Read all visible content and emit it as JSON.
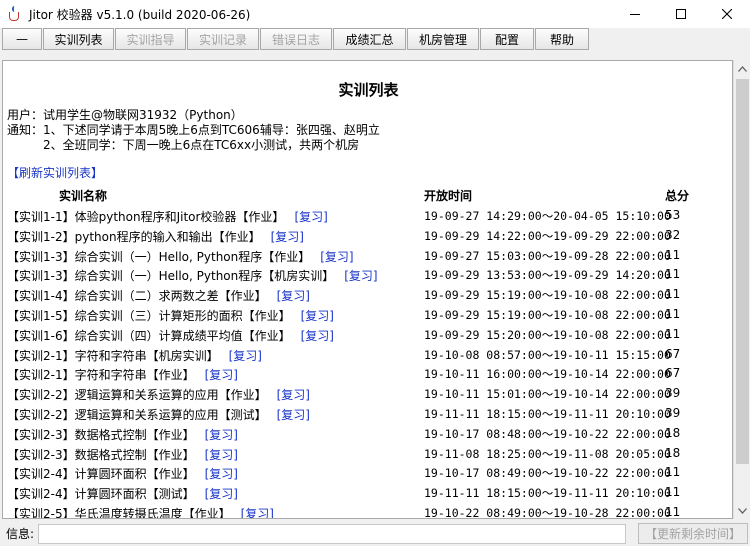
{
  "window": {
    "title": "Jitor 校验器 v5.1.0 (build 2020-06-26)"
  },
  "menu": [
    {
      "label": "—",
      "enabled": true
    },
    {
      "label": "实训列表",
      "enabled": true
    },
    {
      "label": "实训指导",
      "enabled": false
    },
    {
      "label": "实训记录",
      "enabled": false
    },
    {
      "label": "错误日志",
      "enabled": false
    },
    {
      "label": "成绩汇总",
      "enabled": true
    },
    {
      "label": "机房管理",
      "enabled": true
    },
    {
      "label": "配置",
      "enabled": true
    },
    {
      "label": "帮助",
      "enabled": true
    }
  ],
  "page": {
    "title": "实训列表",
    "user_line": "用户：试用学生@物联网31932（Python）",
    "notice_line1": "通知：1、下述同学请于本周5晚上6点到TC606辅导：张四强、赵明立",
    "notice_line2": "2、全班同学：下周一晚上6点在TC6xx小测试，共两个机房",
    "refresh_link": "【刷新实训列表】",
    "col_name": "实训名称",
    "col_time": "开放时间",
    "col_score": "总分",
    "review_label": "[复习]"
  },
  "rows": [
    {
      "name": "【实训1-1】体验python程序和Jitor校验器【作业】",
      "time": "19-09-27 14:29:00～20-04-05 15:10:00",
      "score": "53"
    },
    {
      "name": "【实训1-2】python程序的输入和输出【作业】",
      "time": "19-09-29 14:22:00～19-09-29 22:00:00",
      "score": "32"
    },
    {
      "name": "【实训1-3】综合实训（一）Hello, Python程序【作业】",
      "time": "19-09-27 15:03:00～19-09-28 22:00:00",
      "score": "11"
    },
    {
      "name": "【实训1-3】综合实训（一）Hello, Python程序【机房实训】",
      "time": "19-09-29 13:53:00～19-09-29 14:20:00",
      "score": "11"
    },
    {
      "name": "【实训1-4】综合实训（二）求两数之差【作业】",
      "time": "19-09-29 15:19:00～19-10-08 22:00:00",
      "score": "11"
    },
    {
      "name": "【实训1-5】综合实训（三）计算矩形的面积【作业】",
      "time": "19-09-29 15:19:00～19-10-08 22:00:00",
      "score": "11"
    },
    {
      "name": "【实训1-6】综合实训（四）计算成绩平均值【作业】",
      "time": "19-09-29 15:20:00～19-10-08 22:00:00",
      "score": "11"
    },
    {
      "name": "【实训2-1】字符和字符串【机房实训】",
      "time": "19-10-08 08:57:00～19-10-11 15:15:00",
      "score": "67"
    },
    {
      "name": "【实训2-1】字符和字符串【作业】",
      "time": "19-10-11 16:00:00～19-10-14 22:00:00",
      "score": "67"
    },
    {
      "name": "【实训2-2】逻辑运算和关系运算的应用【作业】",
      "time": "19-10-11 15:01:00～19-10-14 22:00:00",
      "score": "39"
    },
    {
      "name": "【实训2-2】逻辑运算和关系运算的应用【测试】",
      "time": "19-11-11 18:15:00～19-11-11 20:10:00",
      "score": "39"
    },
    {
      "name": "【实训2-3】数据格式控制【作业】",
      "time": "19-10-17 08:48:00～19-10-22 22:00:00",
      "score": "18"
    },
    {
      "name": "【实训2-3】数据格式控制【作业】",
      "time": "19-11-08 18:25:00～19-11-08 20:05:00",
      "score": "18"
    },
    {
      "name": "【实训2-4】计算圆环面积【作业】",
      "time": "19-10-17 08:49:00～19-10-22 22:00:00",
      "score": "11"
    },
    {
      "name": "【实训2-4】计算圆环面积【测试】",
      "time": "19-11-11 18:15:00～19-11-11 20:10:00",
      "score": "11"
    },
    {
      "name": "【实训2-5】华氏温度转摄氏温度【作业】",
      "time": "19-10-22 08:49:00～19-10-28 22:00:00",
      "score": "11"
    }
  ],
  "status": {
    "label": "信息:",
    "value": "",
    "button": "【更新剩余时间】"
  }
}
